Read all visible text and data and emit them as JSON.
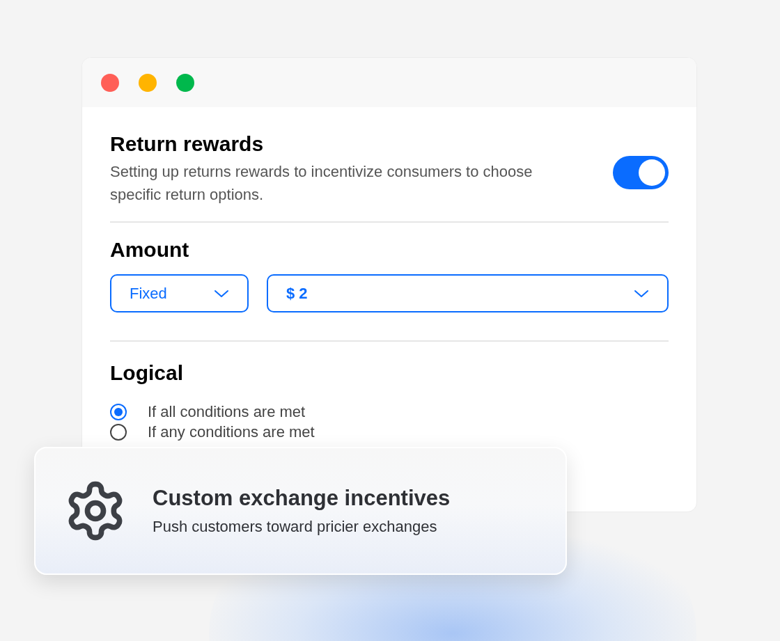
{
  "window": {
    "controls": [
      {
        "color": "#ff5f57"
      },
      {
        "color": "#ffb400"
      },
      {
        "color": "#00b84c"
      }
    ]
  },
  "return_rewards": {
    "title": "Return rewards",
    "description": "Setting up returns rewards to incentivize consumers to choose specific return options.",
    "on": true
  },
  "amount": {
    "title": "Amount",
    "type_select": {
      "value": "Fixed"
    },
    "amount_select": {
      "value": "$ 2"
    }
  },
  "logical": {
    "title": "Logical",
    "options": [
      {
        "label": "If all conditions are met",
        "selected": true
      },
      {
        "label": "If any conditions are met",
        "selected": false
      }
    ]
  },
  "card": {
    "title": "Custom exchange incentives",
    "subtitle": "Push customers toward pricier exchanges"
  }
}
